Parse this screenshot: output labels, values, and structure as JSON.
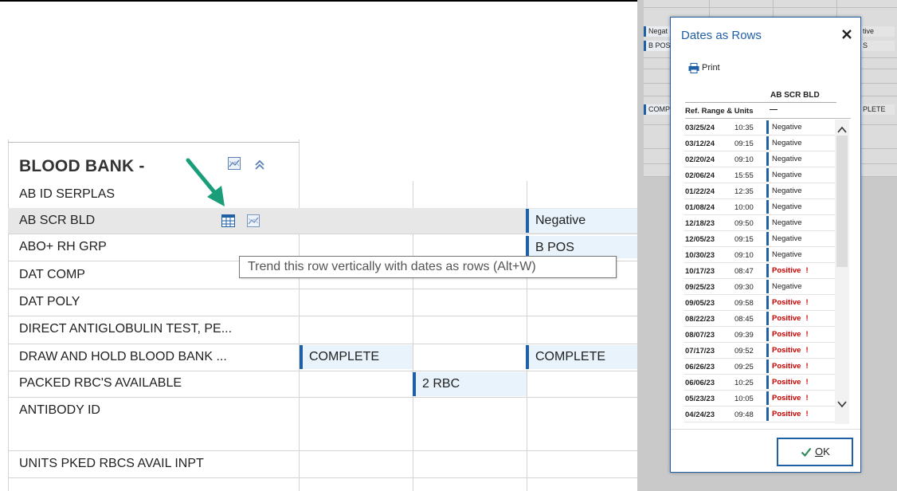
{
  "blood_bank": {
    "section_title": "BLOOD BANK -",
    "tooltip": "Trend this row vertically with dates as rows (Alt+W)",
    "rows": [
      {
        "label": "AB ID SERPLAS"
      },
      {
        "label": "AB SCR BLD"
      },
      {
        "label": "ABO+ RH GRP"
      },
      {
        "label": "DAT COMP"
      },
      {
        "label": "DAT POLY"
      },
      {
        "label": "DIRECT ANTIGLOBULIN TEST, PE..."
      },
      {
        "label": "DRAW AND HOLD BLOOD BANK ..."
      },
      {
        "label": "PACKED RBC'S AVAILABLE"
      },
      {
        "label": "ANTIBODY ID"
      },
      {
        "label": "UNITS PKED RBCS AVAIL INPT"
      }
    ],
    "cells": {
      "ab_scr_bld_col3": "Negative",
      "abo_rh_col3": "B POS",
      "draw_hold_col1": "COMPLETE",
      "draw_hold_col3": "COMPLETE",
      "packed_rbc_col2": "2 RBC"
    }
  },
  "background": {
    "c1": "Negat",
    "c2": "B POS",
    "c3": "COMP",
    "c4": "tive",
    "c5": "S",
    "c6": "PLETE"
  },
  "dialog": {
    "title": "Dates as Rows",
    "print_label": "Print",
    "column_header": "AB SCR BLD",
    "ref_label": "Ref. Range & Units",
    "ref_value": "—",
    "ok_label": "OK",
    "ok_mnemonic": "O",
    "rows": [
      {
        "date": "03/25/24",
        "time": "10:35",
        "result": "Negative",
        "flag": ""
      },
      {
        "date": "03/12/24",
        "time": "09:15",
        "result": "Negative",
        "flag": ""
      },
      {
        "date": "02/20/24",
        "time": "09:10",
        "result": "Negative",
        "flag": ""
      },
      {
        "date": "02/06/24",
        "time": "15:55",
        "result": "Negative",
        "flag": ""
      },
      {
        "date": "01/22/24",
        "time": "12:35",
        "result": "Negative",
        "flag": ""
      },
      {
        "date": "01/08/24",
        "time": "10:00",
        "result": "Negative",
        "flag": ""
      },
      {
        "date": "12/18/23",
        "time": "09:50",
        "result": "Negative",
        "flag": ""
      },
      {
        "date": "12/05/23",
        "time": "09:15",
        "result": "Negative",
        "flag": ""
      },
      {
        "date": "10/30/23",
        "time": "09:10",
        "result": "Negative",
        "flag": ""
      },
      {
        "date": "10/17/23",
        "time": "08:47",
        "result": "Positive",
        "flag": "!"
      },
      {
        "date": "09/25/23",
        "time": "09:30",
        "result": "Negative",
        "flag": ""
      },
      {
        "date": "09/05/23",
        "time": "09:58",
        "result": "Positive",
        "flag": "!"
      },
      {
        "date": "08/22/23",
        "time": "08:45",
        "result": "Positive",
        "flag": "!"
      },
      {
        "date": "08/07/23",
        "time": "09:39",
        "result": "Positive",
        "flag": "!"
      },
      {
        "date": "07/17/23",
        "time": "09:52",
        "result": "Positive",
        "flag": "!"
      },
      {
        "date": "06/26/23",
        "time": "09:25",
        "result": "Positive",
        "flag": "!"
      },
      {
        "date": "06/06/23",
        "time": "10:25",
        "result": "Positive",
        "flag": "!"
      },
      {
        "date": "05/23/23",
        "time": "10:05",
        "result": "Positive",
        "flag": "!"
      },
      {
        "date": "04/24/23",
        "time": "09:48",
        "result": "Positive",
        "flag": "!"
      }
    ]
  },
  "colors": {
    "accent": "#1f5fa6",
    "cell_bg": "#e8f3fb",
    "positive": "#cc0000",
    "arrow": "#1a9e7a"
  },
  "icons": [
    "trend-graph-icon",
    "collapse-chevrons-icon",
    "table-icon",
    "close-icon",
    "printer-icon",
    "checkmark-icon",
    "scroll-up-icon",
    "scroll-down-icon",
    "pointer-arrow-icon"
  ]
}
